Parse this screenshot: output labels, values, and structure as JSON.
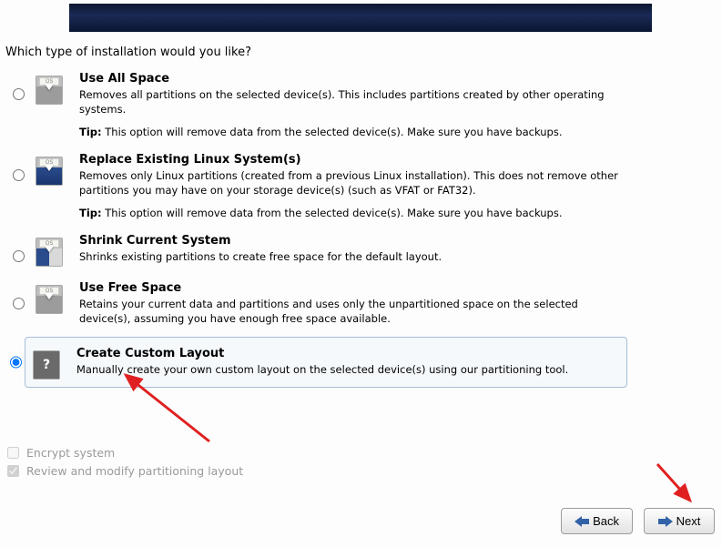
{
  "prompt": "Which type of installation would you like?",
  "options": [
    {
      "key": "use-all-space",
      "title": "Use All Space",
      "desc": "Removes all partitions on the selected device(s).  This includes partitions created by other operating systems.",
      "tip_label": "Tip:",
      "tip": " This option will remove data from the selected device(s).  Make sure you have backups.",
      "icon": "gray",
      "selected": false
    },
    {
      "key": "replace-linux",
      "title": "Replace Existing Linux System(s)",
      "desc": "Removes only Linux partitions (created from a previous Linux installation).  This does not remove other partitions you may have on your storage device(s) (such as VFAT or FAT32).",
      "tip_label": "Tip:",
      "tip": " This option will remove data from the selected device(s).  Make sure you have backups.",
      "icon": "blue",
      "selected": false
    },
    {
      "key": "shrink",
      "title": "Shrink Current System",
      "desc": "Shrinks existing partitions to create free space for the default layout.",
      "tip_label": "",
      "tip": "",
      "icon": "teal",
      "selected": false
    },
    {
      "key": "use-free-space",
      "title": "Use Free Space",
      "desc": "Retains your current data and partitions and uses only the unpartitioned space on the selected device(s), assuming you have enough free space available.",
      "tip_label": "",
      "tip": "",
      "icon": "gray",
      "selected": false
    },
    {
      "key": "custom-layout",
      "title": "Create Custom Layout",
      "desc": "Manually create your own custom layout on the selected device(s) using our partitioning tool.",
      "tip_label": "",
      "tip": "",
      "icon": "question",
      "selected": true
    }
  ],
  "checkboxes": {
    "encrypt": {
      "label": "Encrypt system",
      "checked": false
    },
    "review": {
      "label": "Review and modify partitioning layout",
      "checked": true
    }
  },
  "buttons": {
    "back": "Back",
    "next": "Next"
  }
}
